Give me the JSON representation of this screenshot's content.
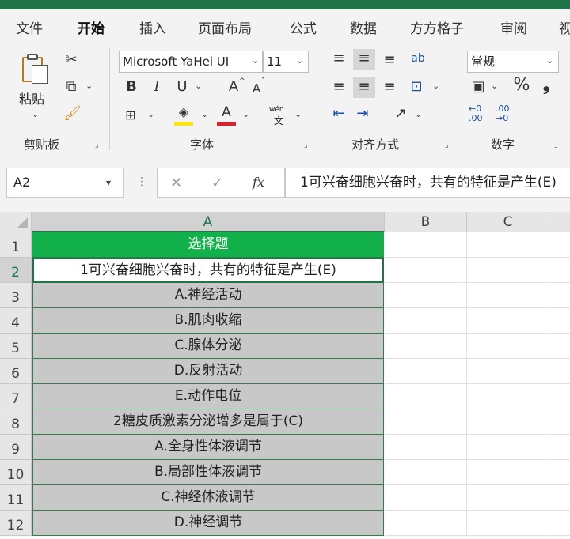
{
  "tabs": [
    "文件",
    "开始",
    "插入",
    "页面布局",
    "公式",
    "数据",
    "方方格子",
    "审阅",
    "视"
  ],
  "active_tab": "开始",
  "clipboard": {
    "paste_label": "粘贴",
    "group_label": "剪贴板"
  },
  "font": {
    "name": "Microsoft YaHei UI",
    "size": "11",
    "bold": "B",
    "italic": "I",
    "underline": "U",
    "grow": "A",
    "shrink": "A",
    "group_label": "字体",
    "fill_color": "#ffe600",
    "font_color": "#e0212a",
    "wen_top": "wén",
    "wen_bottom": "文"
  },
  "alignment": {
    "group_label": "对齐方式",
    "wrap_glyph": "ab"
  },
  "number": {
    "format": "常规",
    "percent": "%",
    "comma": "❟",
    "inc_top": "←0",
    "inc_bottom": ".00",
    "dec_top": ".00",
    "dec_bottom": "→0",
    "group_label": "数字"
  },
  "formula_bar": {
    "name_box": "A2",
    "cancel": "✕",
    "enter": "✓",
    "fx": "fx",
    "content": "1可兴奋细胞兴奋时，共有的特征是产生(E)"
  },
  "sheet": {
    "columns": [
      "A",
      "B",
      "C"
    ],
    "row_numbers": [
      "1",
      "2",
      "3",
      "4",
      "5",
      "6",
      "7",
      "8",
      "9",
      "10",
      "11",
      "12"
    ],
    "rows": [
      "选择题",
      "1可兴奋细胞兴奋时，共有的特征是产生(E)",
      "A.神经活动",
      "B.肌肉收缩",
      "C.腺体分泌",
      "D.反射活动",
      "E.动作电位",
      "2糖皮质激素分泌增多是属于(C)",
      "A.全身性体液调节",
      "B.局部性体液调节",
      "C.神经体液调节",
      "D.神经调节"
    ],
    "header_fill": "#12b04a",
    "option_fill": "#c8c8c8",
    "active_cell": "A2"
  },
  "colors": {
    "accent": "#1f7346"
  }
}
